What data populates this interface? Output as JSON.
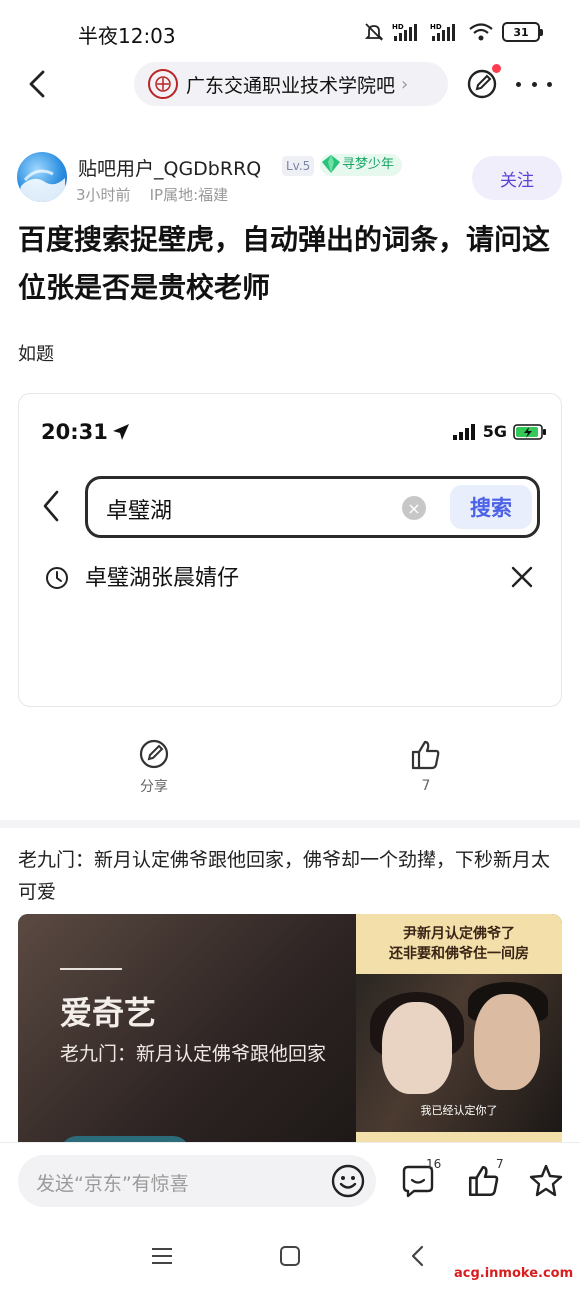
{
  "status_bar": {
    "time": "半夜12:03",
    "battery": "31"
  },
  "nav": {
    "forum_name": "广东交通职业技术学院吧"
  },
  "post": {
    "author": "贴吧用户_QGDbRRQ",
    "level": "Lv.5",
    "title_badge": "寻梦少年",
    "time": "3小时前",
    "ip": "IP属地:福建",
    "follow_label": "关注",
    "title": "百度搜索捉壁虎，自动弹出的词条，请问这位张是否是贵校老师",
    "body": "如题"
  },
  "embedded_screenshot": {
    "time": "20:31",
    "network": "5G",
    "search_query": "卓璧湖",
    "search_button": "搜索",
    "history_item": "卓璧湖张晨婧仔"
  },
  "actions": {
    "share_label": "分享",
    "like_count": "7"
  },
  "recommended": {
    "title": "老九门：新月认定佛爷跟他回家，佛爷却一个劲撵，下秒新月太可爱",
    "brand": "爱奇艺",
    "subtitle": "老九门：新月认定佛爷跟他回家",
    "caption": "尹新月认定佛爷了\n还非要和佛爷住一间房",
    "video_subtitle": "我已经认定你了"
  },
  "bottom_bar": {
    "reply_placeholder": "发送“京东”有惊喜",
    "comment_count": "16",
    "like_count": "7"
  },
  "watermark": "acg.inmoke.com"
}
